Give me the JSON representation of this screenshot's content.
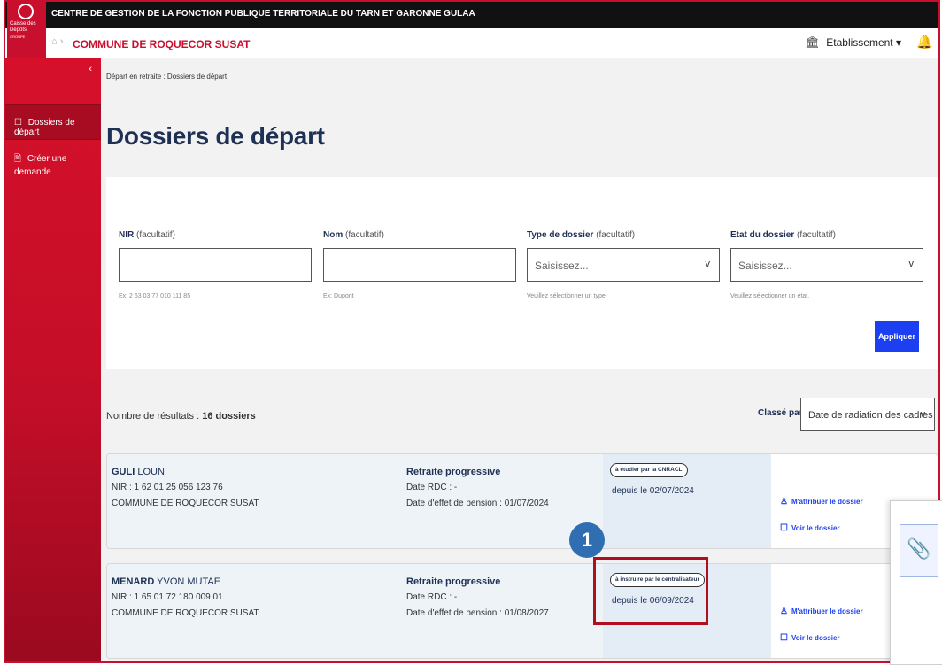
{
  "brand": {
    "logo_text": "Caisse des Dépôts",
    "logo_sub": "GROUPE"
  },
  "header": {
    "org_title": "CENTRE DE GESTION DE LA FONCTION PUBLIQUE TERRITORIALE DU TARN ET GARONNE GULAA",
    "commune": "COMMUNE DE ROQUECOR SUSAT",
    "etablissement_label": "Etablissement ▾"
  },
  "sidebar": {
    "collapse": "‹",
    "items": [
      {
        "label": "Dossiers de départ",
        "icon": "☐"
      },
      {
        "label": "Créer une demande",
        "icon": "🗎"
      }
    ]
  },
  "breadcrumb": "Départ en retraite : Dossiers de départ",
  "page_title": "Dossiers de départ",
  "filters": {
    "nir": {
      "label": "NIR",
      "optional": "(facultatif)",
      "hint": "Ex: 2 63 03 77 010 111 85"
    },
    "nom": {
      "label": "Nom",
      "optional": "(facultatif)",
      "hint": "Ex: Dupont"
    },
    "type": {
      "label": "Type de dossier",
      "optional": "(facultatif)",
      "placeholder": "Saisissez...",
      "hint": "Veuillez sélectionner un type."
    },
    "etat": {
      "label": "Etat du dossier",
      "optional": "(facultatif)",
      "placeholder": "Saisissez...",
      "hint": "Veuillez sélectionner un état."
    },
    "apply_label": "Appliquer"
  },
  "results": {
    "prefix": "Nombre de résultats :",
    "count": "16 dossiers",
    "sort_label": "Classé par",
    "sort_value": "Date de radiation des cadres"
  },
  "dossiers": [
    {
      "last_name": "GULI",
      "first_name": "LOUN",
      "nir": "NIR : 1 62 01 25 056 123 76",
      "commune": "COMMUNE DE ROQUECOR SUSAT",
      "type": "Retraite progressive",
      "rdc": "Date RDC : -",
      "effet": "Date d'effet de pension : 01/07/2024",
      "status": "à étudier par la CNRACL",
      "since": "depuis le 02/07/2024",
      "assign": "M'attribuer le dossier",
      "view": "Voir le dossier"
    },
    {
      "last_name": "MENARD",
      "first_name": "YVON MUTAE",
      "nir": "NIR : 1 65 01 72 180 009 01",
      "commune": "COMMUNE DE ROQUECOR SUSAT",
      "type": "Retraite progressive",
      "rdc": "Date RDC : -",
      "effet": "Date d'effet de pension : 01/08/2027",
      "status": "à instruire par le centralisateur",
      "since": "depuis le 06/09/2024",
      "assign": "M'attribuer le dossier",
      "view": "Voir le dossier"
    }
  ],
  "annotation": {
    "step": "1"
  },
  "colors": {
    "brand_red": "#c8102e",
    "navy": "#1e3053",
    "primary_blue": "#1c3ff2",
    "step_blue": "#2f6fb1"
  }
}
